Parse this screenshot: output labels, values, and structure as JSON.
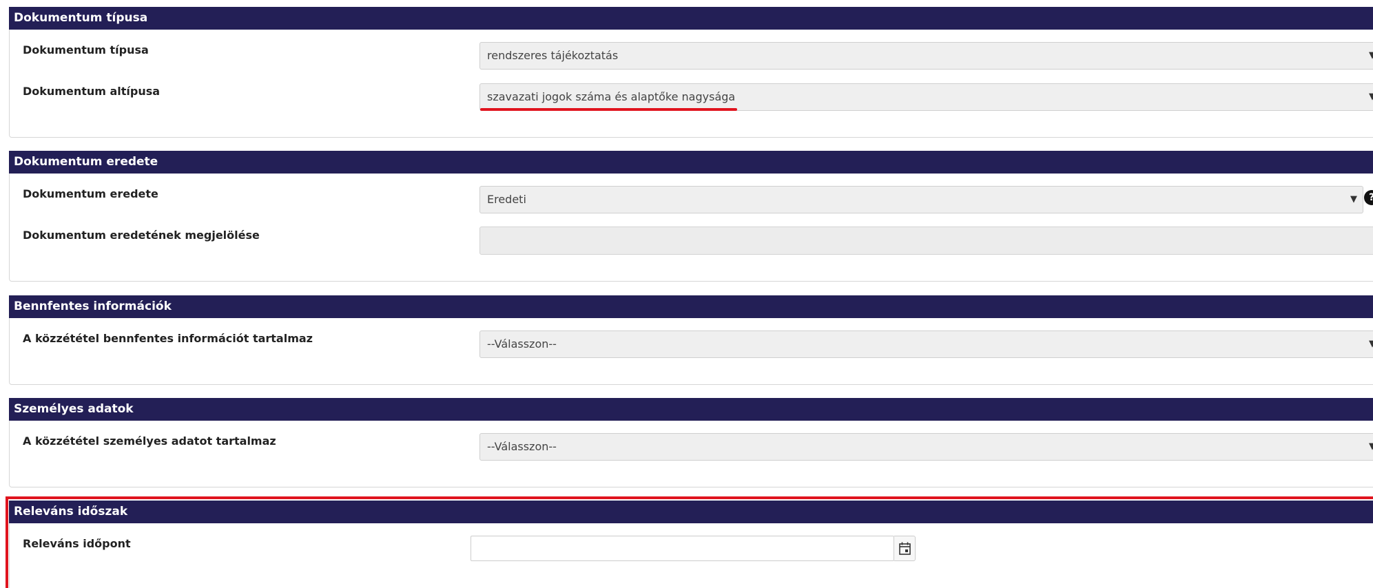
{
  "sections": [
    {
      "title": "Dokumentum típusa",
      "fields": [
        {
          "label": "Dokumentum típusa",
          "value": "rendszeres tájékoztatás"
        },
        {
          "label": "Dokumentum altípusa",
          "value": "szavazati jogok száma és alaptőke nagysága"
        }
      ]
    },
    {
      "title": "Dokumentum eredete",
      "fields": [
        {
          "label": "Dokumentum eredete",
          "value": "Eredeti"
        },
        {
          "label": "Dokumentum eredetének megjelölése",
          "value": ""
        }
      ]
    },
    {
      "title": "Bennfentes információk",
      "fields": [
        {
          "label": "A közzététel bennfentes információt tartalmaz",
          "value": "--Válasszon--"
        }
      ]
    },
    {
      "title": "Személyes adatok",
      "fields": [
        {
          "label": "A közzététel személyes adatot tartalmaz",
          "value": "--Válasszon--"
        }
      ]
    },
    {
      "title": "Releváns időszak",
      "fields": [
        {
          "label": "Releváns időpont",
          "value": ""
        }
      ]
    }
  ],
  "icons": {
    "dropdown": "caret-down-icon",
    "help": "question-circle-icon",
    "calendar": "calendar-icon"
  },
  "help_glyph": "?",
  "colors": {
    "header_bg": "#231f56",
    "annotation_red": "#e0141e"
  }
}
